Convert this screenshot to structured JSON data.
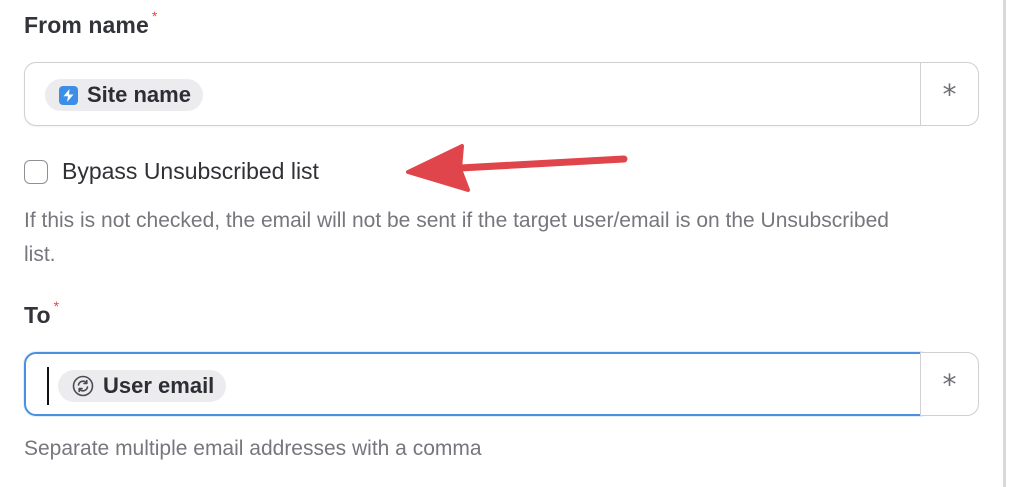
{
  "from_name": {
    "label": "From name",
    "required_mark": "*",
    "token": {
      "label": "Site name",
      "icon": "lightning-icon",
      "icon_color": "#3d8ee6"
    },
    "suffix": "*"
  },
  "bypass": {
    "label": "Bypass Unsubscribed list",
    "checked": false,
    "help": "If this is not checked, the email will not be sent if the target user/email is on the Unsubscribed list."
  },
  "to": {
    "label": "To",
    "required_mark": "*",
    "token": {
      "label": "User email",
      "icon": "cycle-icon"
    },
    "suffix": "*",
    "help": "Separate multiple email addresses with a comma"
  },
  "colors": {
    "accent": "#4a8fe0",
    "required": "#e64545",
    "annotation_arrow": "#e0454b"
  }
}
